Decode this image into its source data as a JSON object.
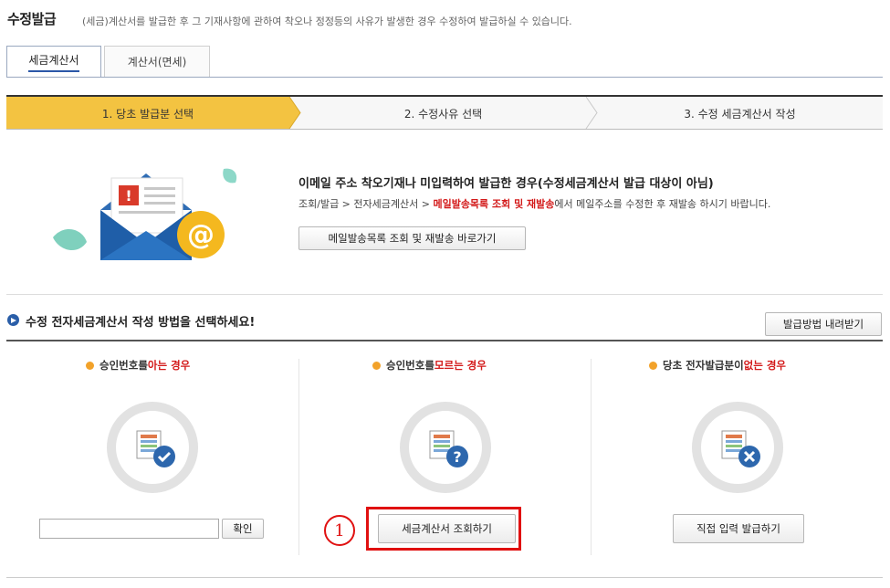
{
  "header": {
    "title": "수정발급",
    "description": "(세금)계산서를 발급한 후 그 기재사항에 관하여 착오나 정정등의 사유가 발생한 경우 수정하여 발급하실 수 있습니다."
  },
  "tabs": [
    {
      "label": "세금계산서",
      "active": true
    },
    {
      "label": "계산서(면세)",
      "active": false
    }
  ],
  "steps": [
    {
      "label": "1. 당초 발급분 선택",
      "active": true
    },
    {
      "label": "2. 수정사유 선택",
      "active": false
    },
    {
      "label": "3. 수정 세금계산서 작성",
      "active": false
    }
  ],
  "email_notice": {
    "title": "이메일 주소 착오기재나 미입력하여 발급한 경우(수정세금계산서 발급 대상이 아님)",
    "desc_prefix": "조회/발급 > 전자세금계산서 > ",
    "desc_highlight": "메일발송목록 조회 및 재발송",
    "desc_suffix": "에서 메일주소를 수정한 후 재발송 하시기 바랍니다.",
    "button": "메일발송목록 조회 및 재발송 바로가기"
  },
  "method": {
    "title": "수정 전자세금계산서 작성 방법을 선택하세요!",
    "download_button": "발급방법 내려받기"
  },
  "columns": [
    {
      "pre": "승인번호를 ",
      "red": "아는 경우",
      "post": "",
      "icon": "check-icon"
    },
    {
      "pre": "승인번호를 ",
      "red": "모르는 경우",
      "post": "",
      "icon": "question-icon"
    },
    {
      "pre": "당초 전자발급분이 ",
      "red": "없는 경우",
      "post": "",
      "icon": "x-icon"
    }
  ],
  "approval_input": {
    "value": "",
    "placeholder": ""
  },
  "confirm_button": "확인",
  "lookup_button": "세금계산서 조회하기",
  "direct_button": "직접 입력 발급하기",
  "annotation_number": "1",
  "colors": {
    "accent_step": "#f3c341",
    "highlight": "#d31a1a",
    "annotation": "#e01010",
    "bullet": "#2a5ea8"
  }
}
